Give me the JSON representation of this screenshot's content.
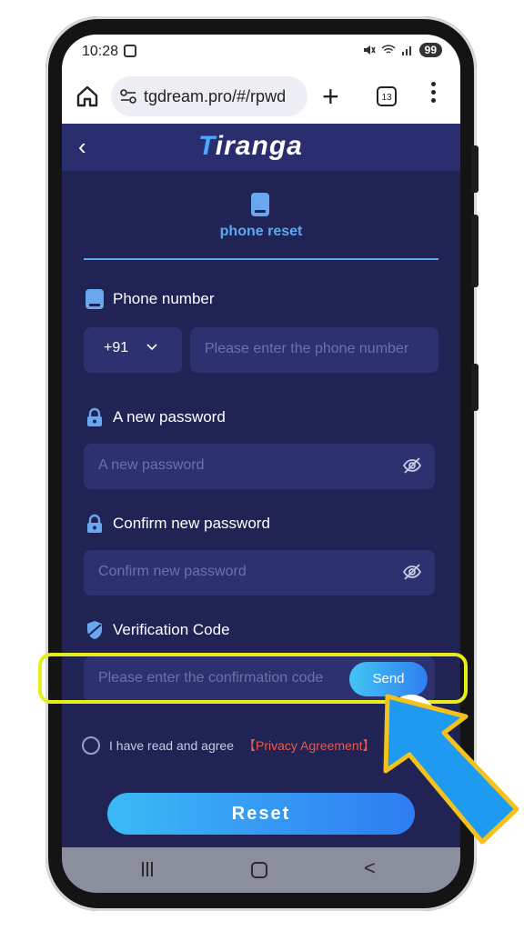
{
  "status_bar": {
    "time": "10:28",
    "battery": "99",
    "icons": [
      "screenshot-icon",
      "mute-icon",
      "wifi-icon",
      "signal-icon"
    ]
  },
  "browser": {
    "url": "tgdream.pro/#/rpwd",
    "tab_count": "13"
  },
  "app": {
    "logo_main": "iranga",
    "logo_prefix": "T"
  },
  "tab": {
    "label": "phone reset"
  },
  "form": {
    "phone": {
      "label": "Phone number",
      "country_code": "+91",
      "placeholder": "Please enter the phone number"
    },
    "password": {
      "label": "A new password",
      "placeholder": "A new password"
    },
    "confirm": {
      "label": "Confirm new password",
      "placeholder": "Confirm new password"
    },
    "code": {
      "label": "Verification Code",
      "placeholder": "Please enter the confirmation code",
      "send": "Send"
    },
    "agree_text": "I have read and agree",
    "privacy_link": "【Privacy Agreement】",
    "reset": "Reset"
  },
  "colors": {
    "bg": "#202354",
    "accent": "#5ba8f3",
    "highlight": "#e5ee1b",
    "arrow": "#1e9bf0",
    "privacy": "#e85a4f"
  }
}
